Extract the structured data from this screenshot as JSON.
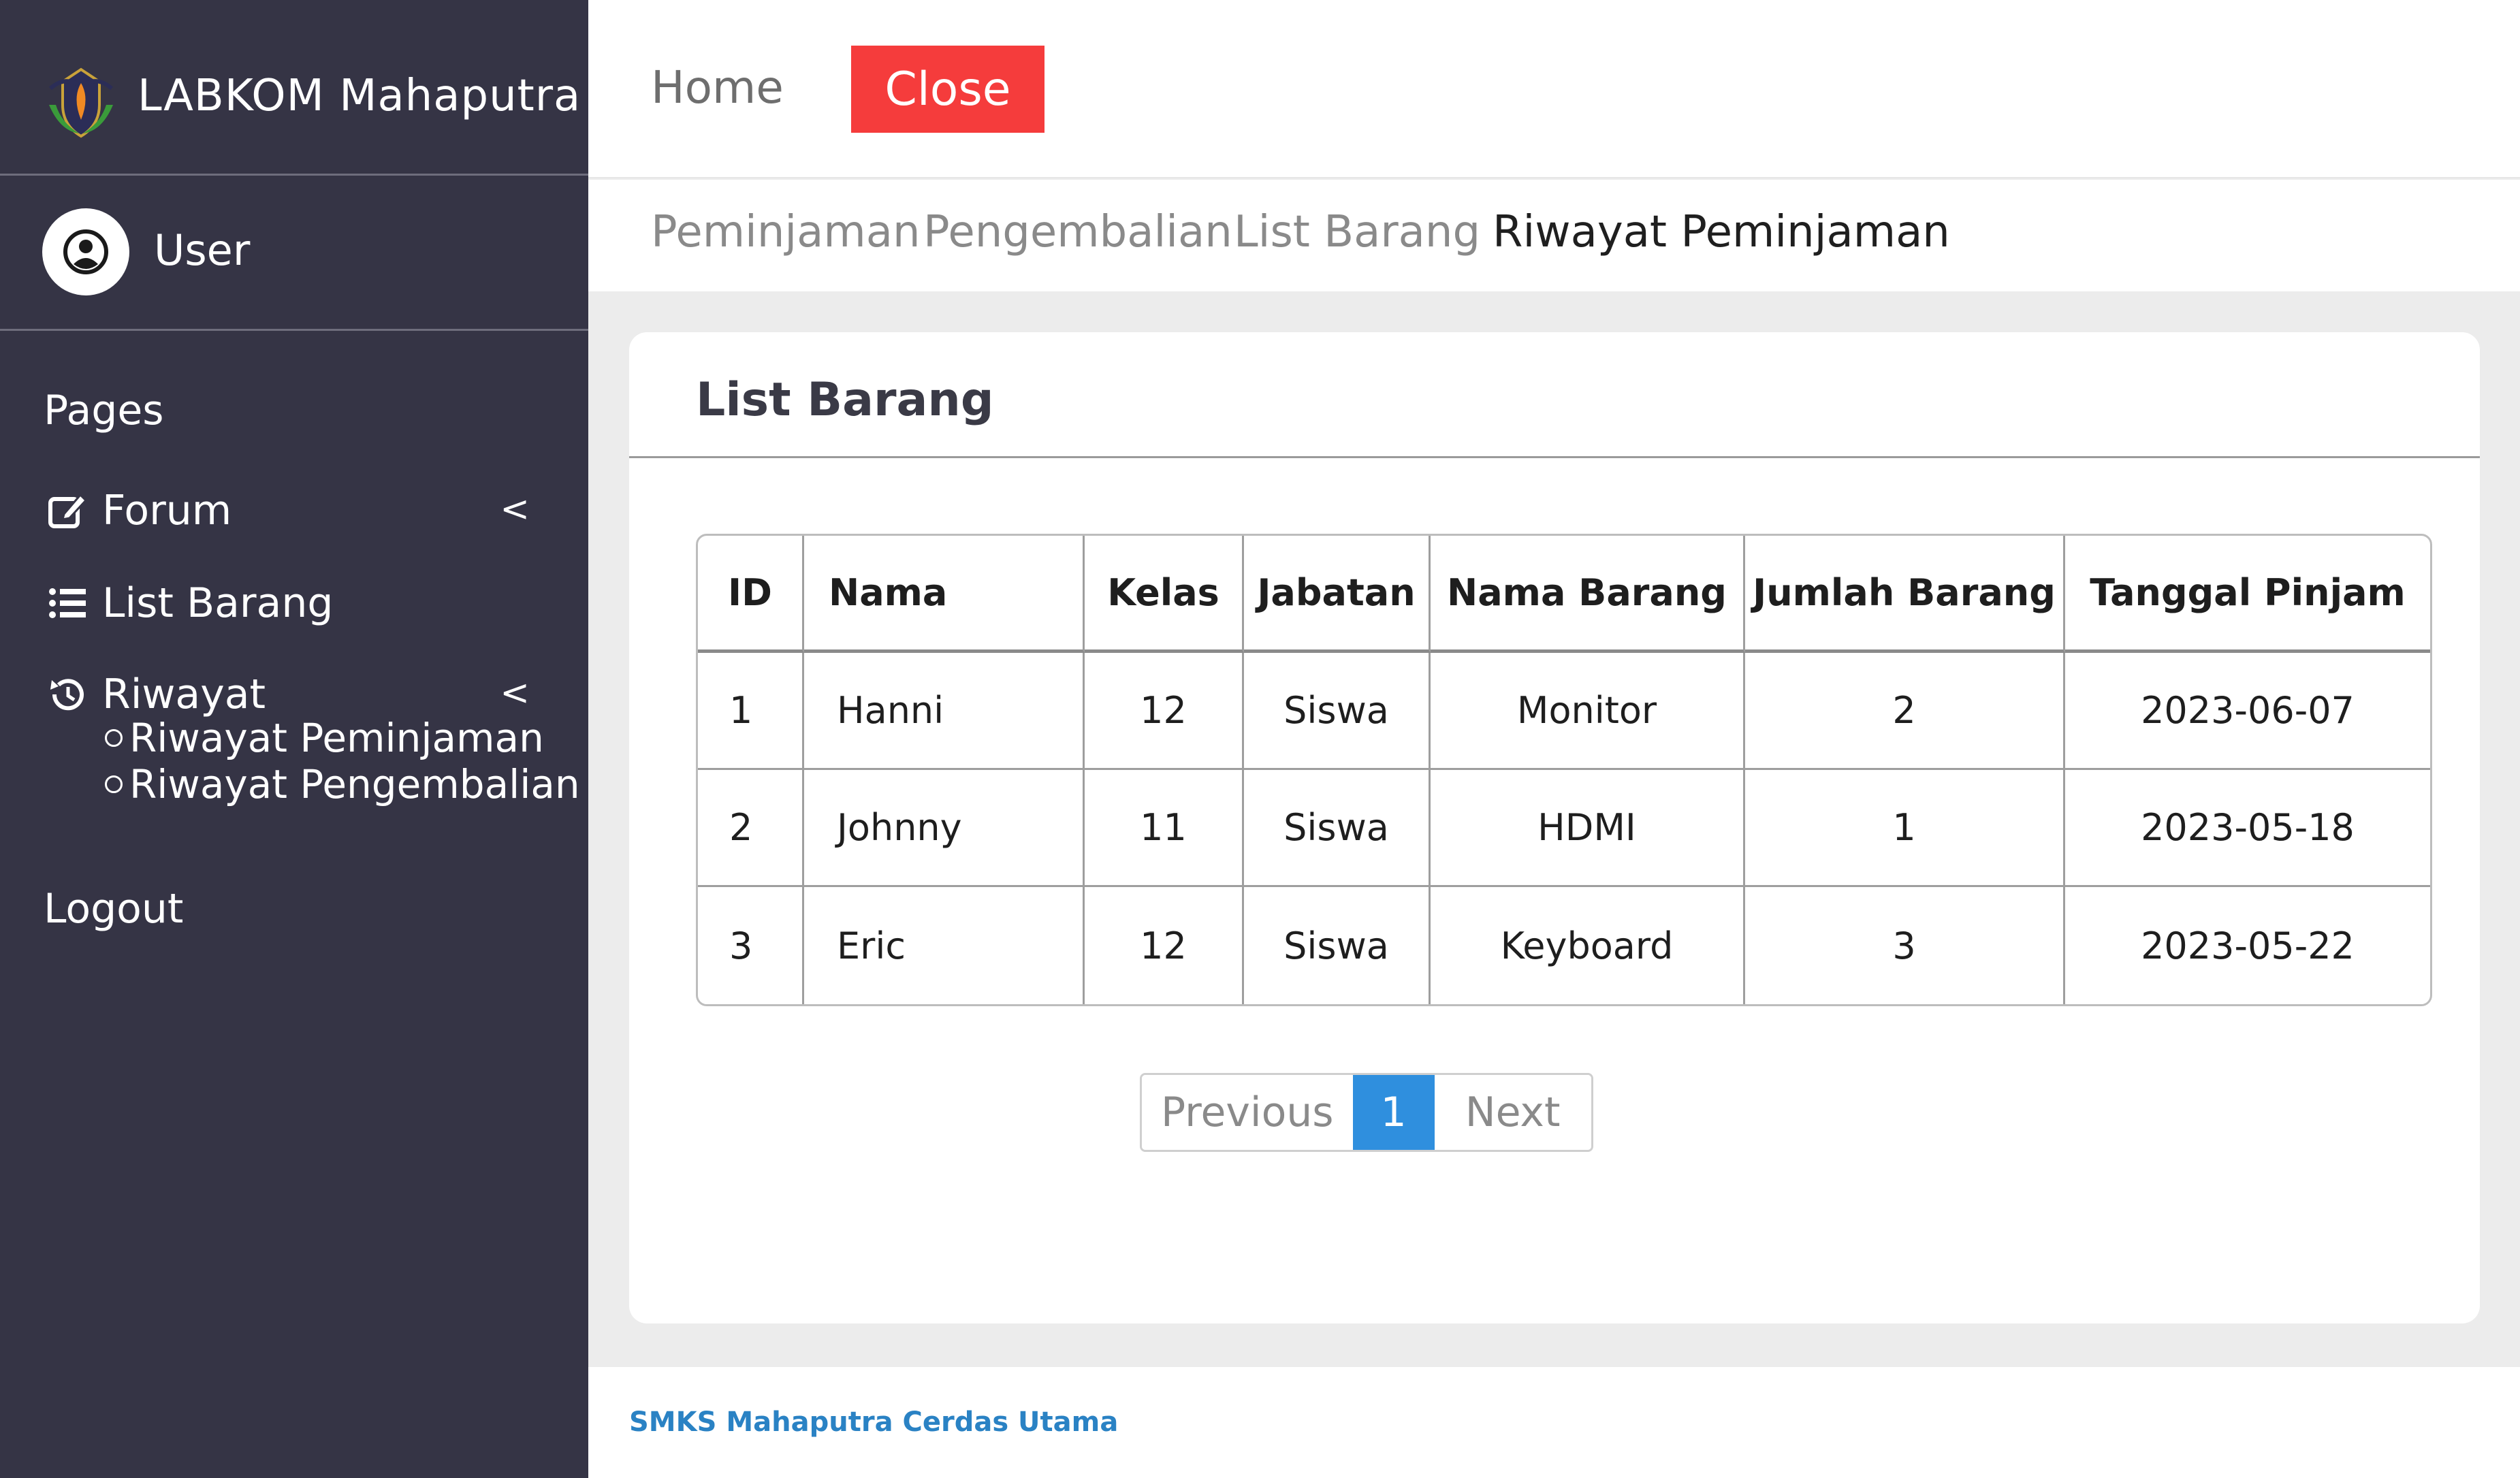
{
  "sidebar": {
    "brand": "LABKOM Mahaputra",
    "user": "User",
    "section": "Pages",
    "items": [
      {
        "label": "Forum",
        "icon": "edit-icon",
        "caret": "<"
      },
      {
        "label": "List Barang",
        "icon": "list-icon"
      },
      {
        "label": "Riwayat",
        "icon": "history-icon",
        "caret": "<",
        "children": [
          "Riwayat Peminjaman",
          "Riwayat Pengembalian"
        ]
      }
    ],
    "logout": "Logout"
  },
  "topbar": {
    "home": "Home",
    "close": "Close"
  },
  "subnav": [
    "Peminjaman",
    "Pengembalian",
    "List Barang",
    "Riwayat Peminjaman"
  ],
  "card": {
    "title": "List Barang",
    "columns": [
      "ID",
      "Nama",
      "Kelas",
      "Jabatan",
      "Nama Barang",
      "Jumlah Barang",
      "Tanggal Pinjam"
    ],
    "rows": [
      [
        "1",
        "Hanni",
        "12",
        "Siswa",
        "Monitor",
        "2",
        "2023-06-07"
      ],
      [
        "2",
        "Johnny",
        "11",
        "Siswa",
        "HDMI",
        "1",
        "2023-05-18"
      ],
      [
        "3",
        "Eric",
        "12",
        "Siswa",
        "Keyboard",
        "3",
        "2023-05-22"
      ]
    ]
  },
  "pagination": {
    "previous": "Previous",
    "current": "1",
    "next": "Next"
  },
  "footer": "SMKS Mahaputra Cerdas Utama",
  "colors": {
    "sidebar": "#353445",
    "close": "#f53c3c",
    "page_active": "#2f8fde",
    "footer_text": "#2a82c4"
  }
}
